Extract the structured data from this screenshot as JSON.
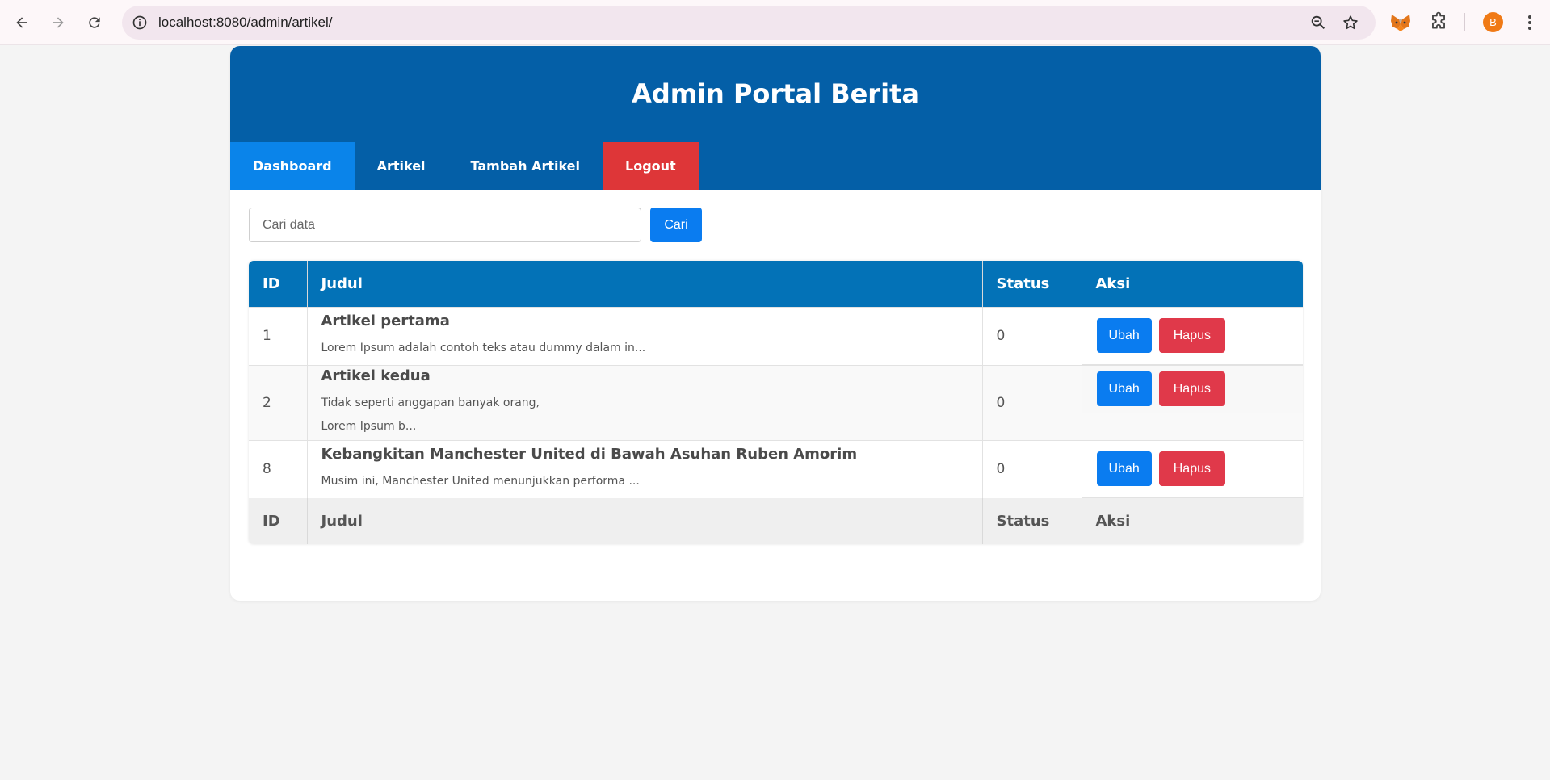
{
  "browser": {
    "url": "localhost:8080/admin/artikel/",
    "avatar_letter": "B",
    "icons": [
      "back-icon",
      "forward-icon",
      "reload-icon",
      "site-info-icon",
      "zoom-icon",
      "bookmark-star-icon",
      "metamask-fox-icon",
      "extensions-puzzle-icon",
      "more-menu-icon"
    ]
  },
  "header": {
    "title": "Admin Portal Berita",
    "menu": [
      {
        "label": "Dashboard"
      },
      {
        "label": "Artikel"
      },
      {
        "label": "Tambah Artikel"
      },
      {
        "label": "Logout"
      }
    ]
  },
  "search": {
    "placeholder": "Cari data",
    "button_label": "Cari"
  },
  "table": {
    "headers": [
      "ID",
      "Judul",
      "Status",
      "Aksi"
    ],
    "rows": [
      {
        "id": "1",
        "title": "Artikel pertama",
        "excerpt": "Lorem Ipsum adalah contoh teks atau dummy dalam in...",
        "status": "0",
        "edit": "Ubah",
        "delete": "Hapus"
      },
      {
        "id": "2",
        "title": "Artikel kedua",
        "excerpt": "Tidak seperti anggapan banyak orang, Lorem Ipsum b...",
        "status": "0",
        "edit": "Ubah",
        "delete": "Hapus"
      },
      {
        "id": "8",
        "title": "Kebangkitan Manchester United di Bawah Asuhan Ruben Amorim",
        "excerpt": "Musim ini, Manchester United menunjukkan performa ...",
        "status": "0",
        "edit": "Ubah",
        "delete": "Hapus"
      }
    ]
  },
  "colors": {
    "header_bg": "#045fa7",
    "active_menu": "#0a84ea",
    "logout": "#de3638",
    "primary_button": "#0a7cf0",
    "danger_button": "#e0394a",
    "table_head": "#0372b7"
  }
}
